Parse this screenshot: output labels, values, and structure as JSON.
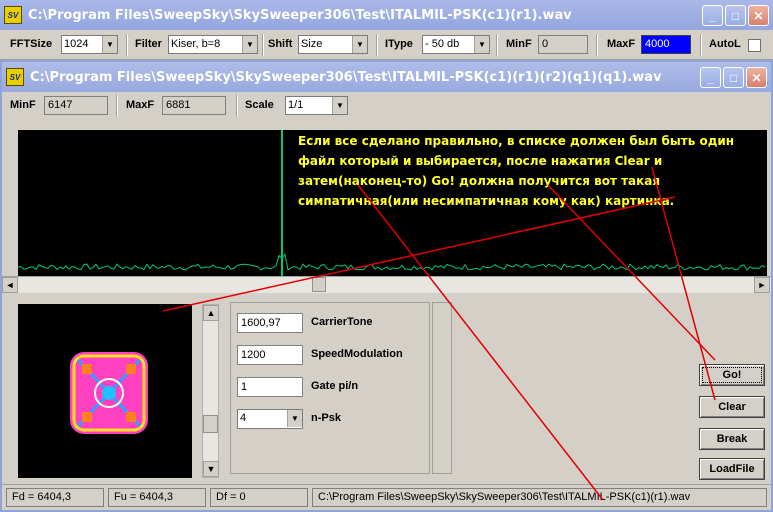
{
  "main_window": {
    "icon_text": "SV",
    "title": "C:\\Program Files\\SweepSky\\SkySweeper306\\Test\\ITALMIL-PSK(c1)(r1).wav",
    "controls": {
      "minimize": "_",
      "maximize": "□",
      "close": "✕"
    }
  },
  "toolbar": {
    "fftsize_label": "FFTSize",
    "fftsize_value": "1024",
    "filter_label": "Filter",
    "filter_value": "Kiser, b=8",
    "shift_label": "Shift",
    "shift_value": "Size",
    "itype_label": "IType",
    "itype_value": "- 50 db",
    "minf_label": "MinF",
    "minf_value": "0",
    "maxf_label": "MaxF",
    "maxf_value": "4000",
    "autol_label": "AutoL"
  },
  "child_window": {
    "icon_text": "SV",
    "title": "C:\\Program Files\\SweepSky\\SkySweeper306\\Test\\ITALMIL-PSK(c1)(r1)(r2)(q1)(q1).wav",
    "controls": {
      "minimize": "_",
      "maximize": "□",
      "close": "✕"
    }
  },
  "subbar": {
    "minf_label": "MinF",
    "minf_value": "6147",
    "maxf_label": "MaxF",
    "maxf_value": "6881",
    "scale_label": "Scale",
    "scale_value": "1/1"
  },
  "annotation": {
    "text": "Если все сделано правильно, в списке должен был быть один файл который и выбирается, после нажатия Clear и затем(наконец-то) Go! должна получится вот такая симпатичная(или несимпатичная кому как) картинка."
  },
  "params": {
    "carrier_value": "1600,97",
    "carrier_label": "CarrierTone",
    "speed_value": "1200",
    "speed_label": "SpeedModulation",
    "gate_value": "1",
    "gate_label": "Gate pi/n",
    "npsk_value": "4",
    "npsk_label": "n-Psk"
  },
  "buttons": {
    "go": "Go!",
    "clear": "Clear",
    "break": "Break",
    "loadfile": "LoadFile"
  },
  "status": {
    "fd": "Fd = 6404,3",
    "fu": "Fu = 6404,3",
    "df": "Df = 0",
    "file": "C:\\Program Files\\SweepSky\\SkySweeper306\\Test\\ITALMIL-PSK(c1)(r1).wav"
  },
  "colors": {
    "annotation": "#ffff2a",
    "arrows": "#e00000",
    "spectrum_trace": "#00c878",
    "maxf_highlight": "#0000ff"
  },
  "icons": {
    "scroll_left": "◄",
    "scroll_right": "►",
    "scroll_up": "▲",
    "scroll_down": "▼",
    "dropdown": "▼"
  }
}
